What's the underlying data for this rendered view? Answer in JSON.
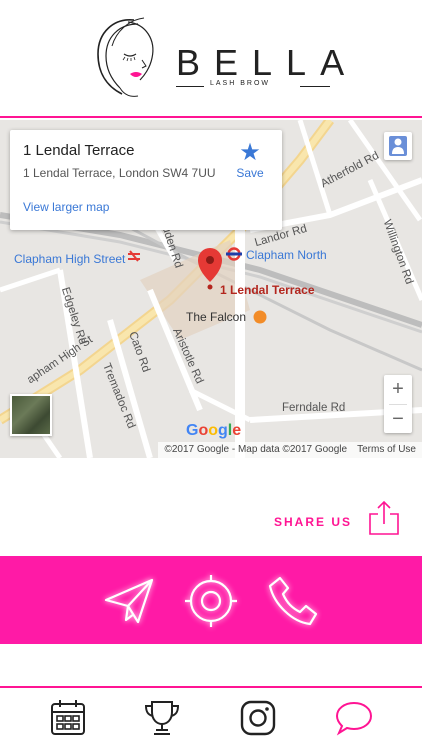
{
  "brand": {
    "name": "BELLA",
    "tagline": "LASH BROW",
    "accent_color": "#ff1493"
  },
  "map": {
    "info_card": {
      "title": "1 Lendal Terrace",
      "address": "1 Lendal Terrace, London SW4 7UU",
      "save_label": "Save",
      "larger_map_link": "View larger map"
    },
    "labels": {
      "pin": "1 Lendal Terrace",
      "clapham_high_street": "Clapham High Street",
      "clapham_north": "Clapham North",
      "the_falcon": "The Falcon",
      "landor_rd": "Landor Rd",
      "atherfold_rd": "Atherfold Rd",
      "willington_rd": "Willington Rd",
      "edgeley_rd": "Edgeley Rd",
      "cato_rd": "Cato Rd",
      "tremadoc_rd": "Tremadoc Rd",
      "aristotle_rd": "Aristotle Rd",
      "ferndale_rd": "Ferndale Rd",
      "clapham_high_st": "apham High St",
      "bedford_rd": "auden Rd"
    },
    "zoom_in": "+",
    "zoom_out": "−",
    "google": [
      "G",
      "o",
      "o",
      "g",
      "l",
      "e"
    ],
    "attribution": "©2017 Google - Map data ©2017 Google",
    "terms": "Terms of Use"
  },
  "share": {
    "label": "SHARE US"
  },
  "actions": [
    {
      "icon": "paper-plane-icon"
    },
    {
      "icon": "target-icon"
    },
    {
      "icon": "phone-icon"
    }
  ],
  "tabs": [
    {
      "icon": "calendar-icon"
    },
    {
      "icon": "trophy-icon"
    },
    {
      "icon": "instagram-icon"
    },
    {
      "icon": "chat-bubble-icon",
      "active": true
    }
  ]
}
